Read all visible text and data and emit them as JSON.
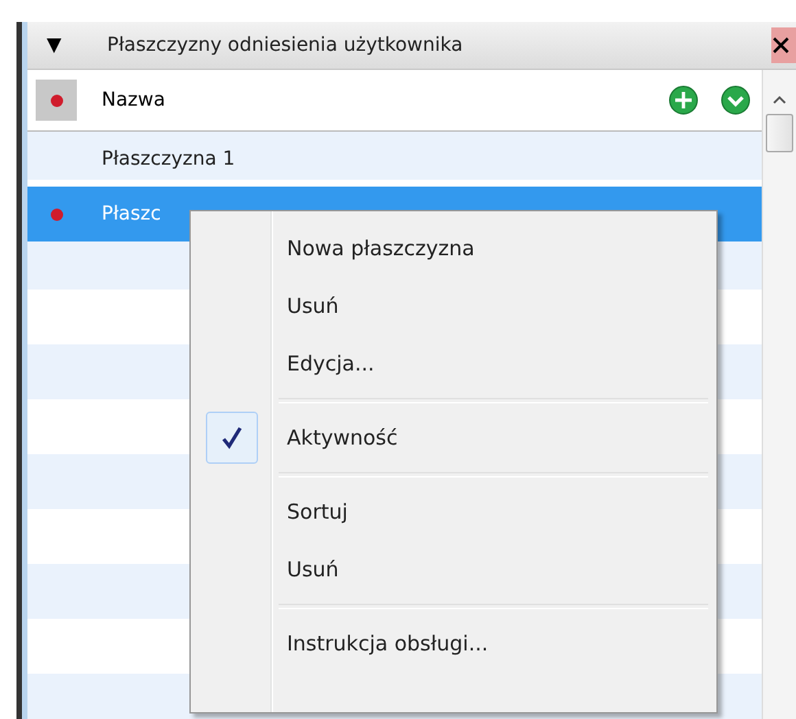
{
  "panel": {
    "title": "Płaszczyzny odniesienia użytkownika",
    "collapse_glyph": "▼"
  },
  "list": {
    "column": "Nazwa",
    "header_marker": true,
    "rows": [
      {
        "name": "Płaszczyzna 1",
        "active": false,
        "selected": false
      },
      {
        "name": "Płaszc",
        "active": true,
        "selected": true
      }
    ]
  },
  "context_menu": {
    "groups": [
      [
        {
          "label": "Nowa płaszczyzna",
          "checked": false
        },
        {
          "label": "Usuń",
          "checked": false
        },
        {
          "label": "Edycja...",
          "checked": false
        }
      ],
      [
        {
          "label": "Aktywność",
          "checked": true
        }
      ],
      [
        {
          "label": "Sortuj",
          "checked": false
        },
        {
          "label": "Usuń",
          "checked": false
        }
      ],
      [
        {
          "label": "Instrukcja obsługi...",
          "checked": false
        }
      ]
    ]
  }
}
